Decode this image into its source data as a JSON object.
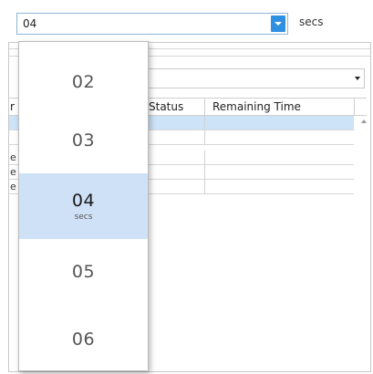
{
  "time_field": {
    "value": "04",
    "unit_label": "secs"
  },
  "grid": {
    "columns": [
      {
        "label": "r"
      },
      {
        "label": "Status"
      },
      {
        "label": "Remaining Time"
      }
    ],
    "rows": [
      {
        "first_fragment": "",
        "selected": true
      },
      {
        "first_fragment": "",
        "selected": false
      },
      {
        "first_fragment": "e",
        "selected": false
      },
      {
        "first_fragment": "e",
        "selected": false
      },
      {
        "first_fragment": "e",
        "selected": false
      }
    ]
  },
  "picker": {
    "items": [
      {
        "value": "02",
        "sub": "",
        "selected": false
      },
      {
        "value": "03",
        "sub": "",
        "selected": false
      },
      {
        "value": "04",
        "sub": "secs",
        "selected": true
      },
      {
        "value": "05",
        "sub": "",
        "selected": false
      },
      {
        "value": "06",
        "sub": "",
        "selected": false
      }
    ]
  },
  "colors": {
    "accent": "#2f8fe0",
    "selection": "#cfe1f6",
    "row_selection": "#cde3f7"
  },
  "icons": {
    "dropdown_arrow": "chevron-down-icon",
    "filter_arrow": "caret-down-icon",
    "scroll_up": "caret-up-icon"
  }
}
